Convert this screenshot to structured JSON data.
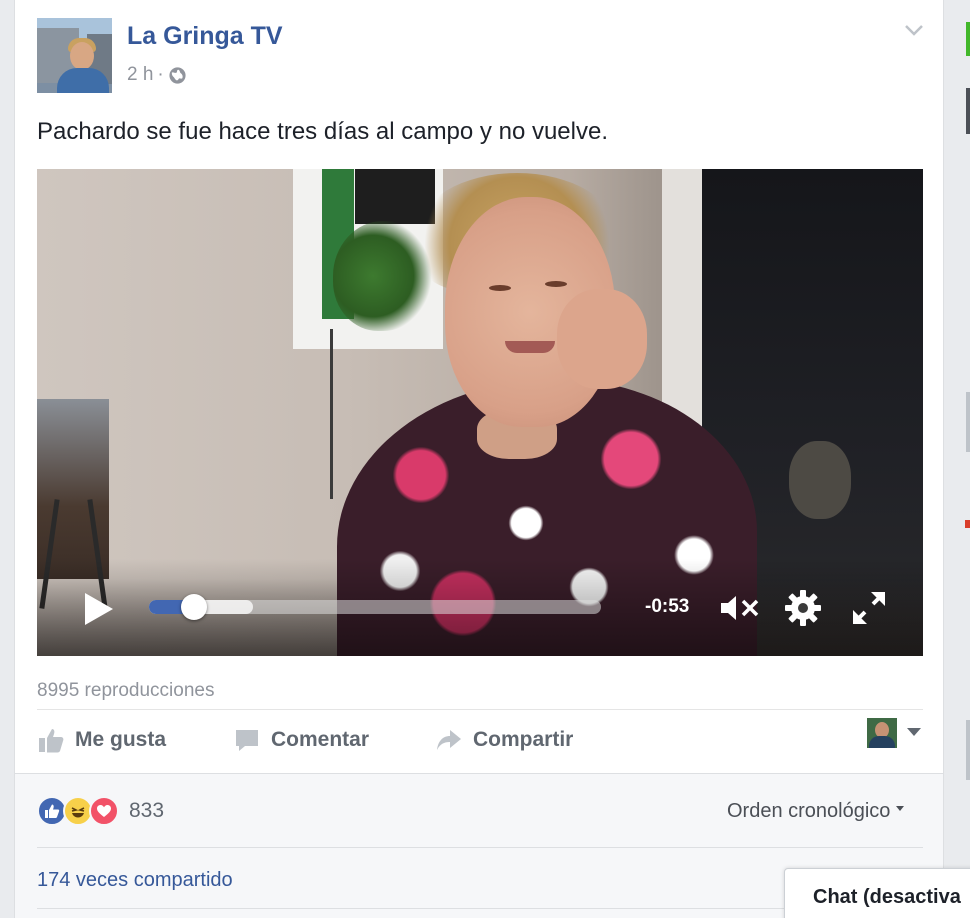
{
  "post": {
    "page_name": "La Gringa TV",
    "timestamp": "2 h",
    "separator": "·",
    "audience_icon": "globe-icon",
    "text": "Pachardo se fue hace tres días al campo y no vuelve."
  },
  "video": {
    "time_remaining": "-0:53",
    "progress_played": 0.1,
    "progress_buffered": 0.23,
    "muted": true,
    "icons": [
      "play-icon",
      "mute-icon",
      "gear-icon",
      "expand-icon"
    ]
  },
  "views_text": "8995 reproducciones",
  "actions": {
    "like": "Me gusta",
    "comment": "Comentar",
    "share": "Compartir"
  },
  "reactions": {
    "types": [
      "like",
      "haha",
      "love"
    ],
    "count": "833"
  },
  "sort_label": "Orden cronológico",
  "shares_text": "174 veces compartido",
  "chat": {
    "label": "Chat (desactiva"
  },
  "colors": {
    "link": "#365899",
    "accent": "#4267b2",
    "muted_text": "#90949c",
    "love": "#f25268",
    "haha": "#f7d04a"
  }
}
